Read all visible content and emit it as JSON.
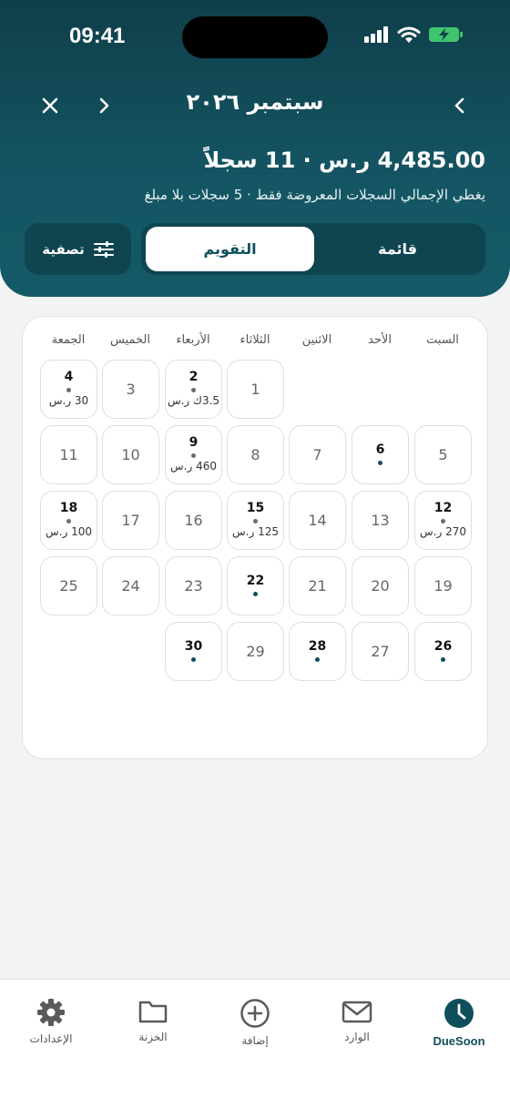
{
  "status": {
    "time": "09:41"
  },
  "header": {
    "month_title": "سبتمبر ٢٠٢٦",
    "summary": "4,485.00 ر.س · 11 سجلاً",
    "subtitle": "يغطي الإجمالي السجلات المعروضة فقط · 5 سجلات بلا مبلغ",
    "view_list_label": "قائمة",
    "view_calendar_label": "التقويم",
    "filter_label": "تصفية"
  },
  "weekdays": [
    "السبت",
    "الأحد",
    "الاثنين",
    "الثلاثاء",
    "الأربعاء",
    "الخميس",
    "الجمعة"
  ],
  "days": [
    {
      "day": "1",
      "has_items": false,
      "amount": ""
    },
    {
      "day": "2",
      "has_items": true,
      "amount": "3.5ك ر.س"
    },
    {
      "day": "3",
      "has_items": false,
      "amount": ""
    },
    {
      "day": "4",
      "has_items": true,
      "amount": "30 ر.س"
    },
    {
      "day": "5",
      "has_items": false,
      "amount": ""
    },
    {
      "day": "6",
      "has_items": true,
      "amount": ""
    },
    {
      "day": "7",
      "has_items": false,
      "amount": ""
    },
    {
      "day": "8",
      "has_items": false,
      "amount": ""
    },
    {
      "day": "9",
      "has_items": true,
      "amount": "460 ر.س"
    },
    {
      "day": "10",
      "has_items": false,
      "amount": ""
    },
    {
      "day": "11",
      "has_items": false,
      "amount": ""
    },
    {
      "day": "12",
      "has_items": true,
      "amount": "270 ر.س"
    },
    {
      "day": "13",
      "has_items": false,
      "amount": ""
    },
    {
      "day": "14",
      "has_items": false,
      "amount": ""
    },
    {
      "day": "15",
      "has_items": true,
      "amount": "125 ر.س"
    },
    {
      "day": "16",
      "has_items": false,
      "amount": ""
    },
    {
      "day": "17",
      "has_items": false,
      "amount": ""
    },
    {
      "day": "18",
      "has_items": true,
      "amount": "100 ر.س"
    },
    {
      "day": "19",
      "has_items": false,
      "amount": ""
    },
    {
      "day": "20",
      "has_items": false,
      "amount": ""
    },
    {
      "day": "21",
      "has_items": false,
      "amount": ""
    },
    {
      "day": "22",
      "has_items": true,
      "amount": ""
    },
    {
      "day": "23",
      "has_items": false,
      "amount": ""
    },
    {
      "day": "24",
      "has_items": false,
      "amount": ""
    },
    {
      "day": "25",
      "has_items": false,
      "amount": ""
    },
    {
      "day": "26",
      "has_items": true,
      "amount": ""
    },
    {
      "day": "27",
      "has_items": false,
      "amount": ""
    },
    {
      "day": "28",
      "has_items": true,
      "amount": ""
    },
    {
      "day": "29",
      "has_items": false,
      "amount": ""
    },
    {
      "day": "30",
      "has_items": true,
      "amount": ""
    }
  ],
  "bottom_nav": {
    "settings": "الإعدادات",
    "vault": "الخزنة",
    "add": "إضافة",
    "inbox": "الوارد",
    "duesoon": "DueSoon"
  },
  "colors": {
    "header": "#145563",
    "accent": "#0f4f5c",
    "dot_amount": "#6b6b6b",
    "dot_plain": "#0f4f5c"
  }
}
